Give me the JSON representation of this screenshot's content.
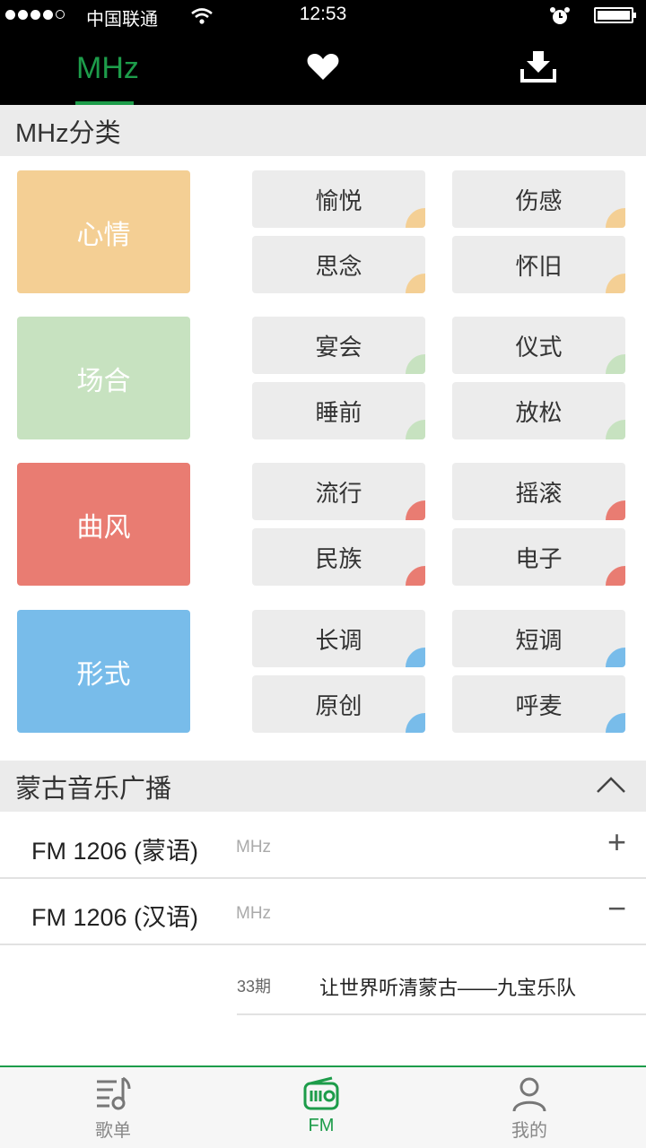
{
  "status_bar": {
    "carrier": "中国联通",
    "time": "12:53"
  },
  "top_tabs": {
    "mhz_label": "MHz",
    "fav_icon": "heart-icon",
    "download_icon": "download-icon",
    "active": "MHz"
  },
  "category_section": {
    "title": "MHz分类",
    "groups": [
      {
        "label": "心情",
        "color": "#f4cf94",
        "items": [
          "愉悦",
          "伤感",
          "思念",
          "怀旧"
        ]
      },
      {
        "label": "场合",
        "color": "#c7e2c0",
        "items": [
          "宴会",
          "仪式",
          "睡前",
          "放松"
        ]
      },
      {
        "label": "曲风",
        "color": "#e97c72",
        "items": [
          "流行",
          "摇滚",
          "民族",
          "电子"
        ]
      },
      {
        "label": "形式",
        "color": "#78bcea",
        "items": [
          "长调",
          "短调",
          "原创",
          "呼麦"
        ]
      }
    ]
  },
  "radio_section": {
    "title": "蒙古音乐广播",
    "stations": [
      {
        "name": "FM 1206 (蒙语)",
        "unit": "MHz",
        "action": "+"
      },
      {
        "name": "FM 1206 (汉语)",
        "unit": "MHz",
        "action": "−"
      }
    ],
    "episodes": [
      {
        "number": "33期",
        "title": "让世界听清蒙古——九宝乐队"
      }
    ]
  },
  "bottom_tabs": [
    {
      "label": "歌单",
      "icon": "playlist-icon"
    },
    {
      "label": "FM",
      "icon": "radio-icon",
      "active": true
    },
    {
      "label": "我的",
      "icon": "profile-icon"
    }
  ],
  "colors": {
    "accent": "#1d9c4a"
  }
}
